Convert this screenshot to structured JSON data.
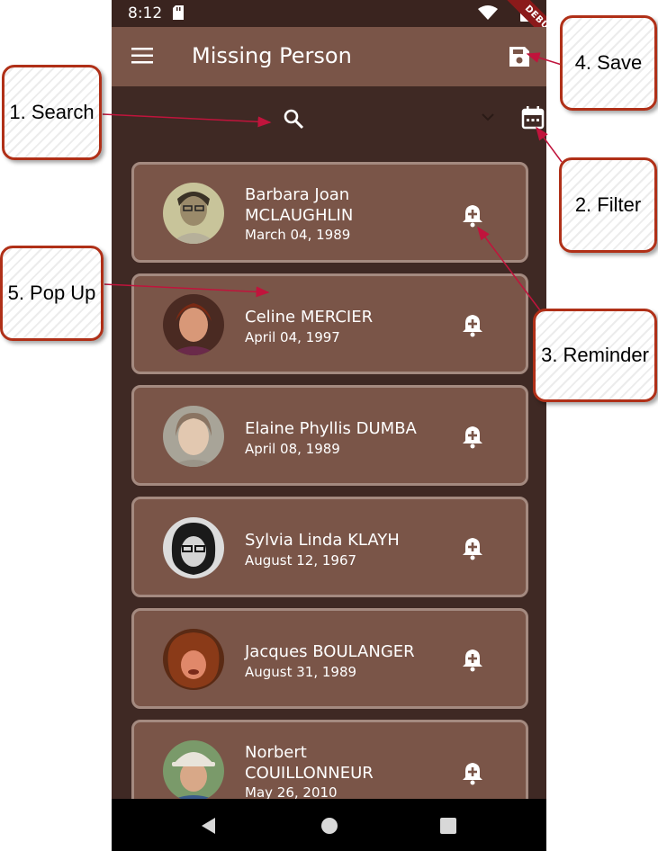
{
  "status_bar": {
    "time": "8:12",
    "debug_label": "DEBUG"
  },
  "app_bar": {
    "title": "Missing Person",
    "menu_icon": "menu-icon",
    "save_icon": "save-icon"
  },
  "filter_bar": {
    "search_icon": "search-icon",
    "dropdown_icon": "chevron-down-icon",
    "filter_icon": "calendar-icon"
  },
  "persons": [
    {
      "name": "Barbara Joan MCLAUGHLIN",
      "date": "March 04, 1989"
    },
    {
      "name": "Celine MERCIER",
      "date": "April 04, 1997"
    },
    {
      "name": "Elaine Phyllis DUMBA",
      "date": "April 08, 1989"
    },
    {
      "name": "Sylvia Linda KLAYH",
      "date": "August 12, 1967"
    },
    {
      "name": "Jacques BOULANGER",
      "date": "August 31, 1989"
    },
    {
      "name": "Norbert COUILLONNEUR",
      "date": "May 26, 2010"
    }
  ],
  "annotations": {
    "search": "1. Search",
    "filter": "2. Filter",
    "reminder": "3. Reminder",
    "save": "4. Save",
    "popup": "5. Pop Up"
  },
  "colors": {
    "background": "#3f2924",
    "app_bar": "#7a5548",
    "card": "#7a5548",
    "card_border": "#a48a80",
    "callout_border": "#b03018",
    "annotation_line": "#c0143c"
  }
}
